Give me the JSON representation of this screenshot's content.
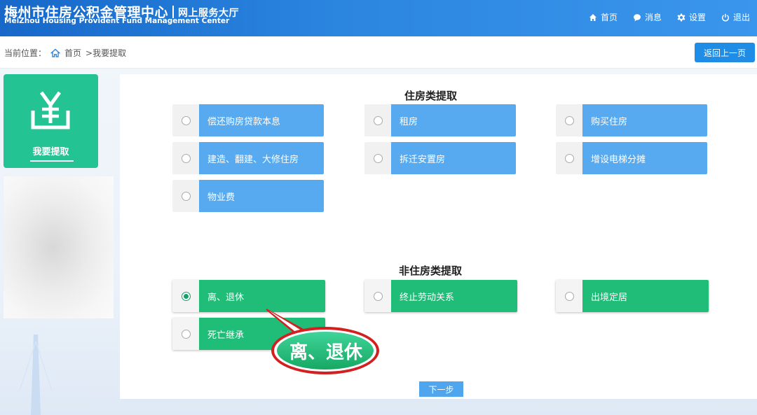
{
  "header": {
    "title": "梅州市住房公积金管理中心",
    "subtitle": "网上服务大厅",
    "english_title": "MeiZhou Housing Provident Fund Management Center",
    "nav": [
      {
        "label": "首页",
        "icon": "home-icon"
      },
      {
        "label": "消息",
        "icon": "message-icon"
      },
      {
        "label": "设置",
        "icon": "gear-icon"
      },
      {
        "label": "退出",
        "icon": "power-icon"
      }
    ]
  },
  "breadcrumb": {
    "prefix": "当前位置：",
    "home": "首页",
    "current": ">我要提取"
  },
  "back_button": "返回上一页",
  "sidebar": {
    "card_label": "我要提取",
    "card_icon": "yen-icon",
    "card_color": "#23c394"
  },
  "housing": {
    "title": "住房类提取",
    "options": [
      {
        "label": "偿还购房贷款本息",
        "checked": false
      },
      {
        "label": "租房",
        "checked": false
      },
      {
        "label": "购买住房",
        "checked": false
      },
      {
        "label": "建造、翻建、大修住房",
        "checked": false
      },
      {
        "label": "拆迁安置房",
        "checked": false
      },
      {
        "label": "增设电梯分摊",
        "checked": false
      },
      {
        "label": "物业费",
        "checked": false
      }
    ]
  },
  "non_housing": {
    "title": "非住房类提取",
    "options": [
      {
        "label": "离、退休",
        "checked": true
      },
      {
        "label": "终止劳动关系",
        "checked": false
      },
      {
        "label": "出境定居",
        "checked": false
      },
      {
        "label": "死亡继承",
        "checked": false
      }
    ]
  },
  "next_button": "下一步",
  "callout": {
    "text": "离、退休",
    "color": "#20bd78"
  },
  "colors": {
    "header": "#1f78d6",
    "option_blue": "#57aaf0",
    "option_green": "#20bd78"
  }
}
